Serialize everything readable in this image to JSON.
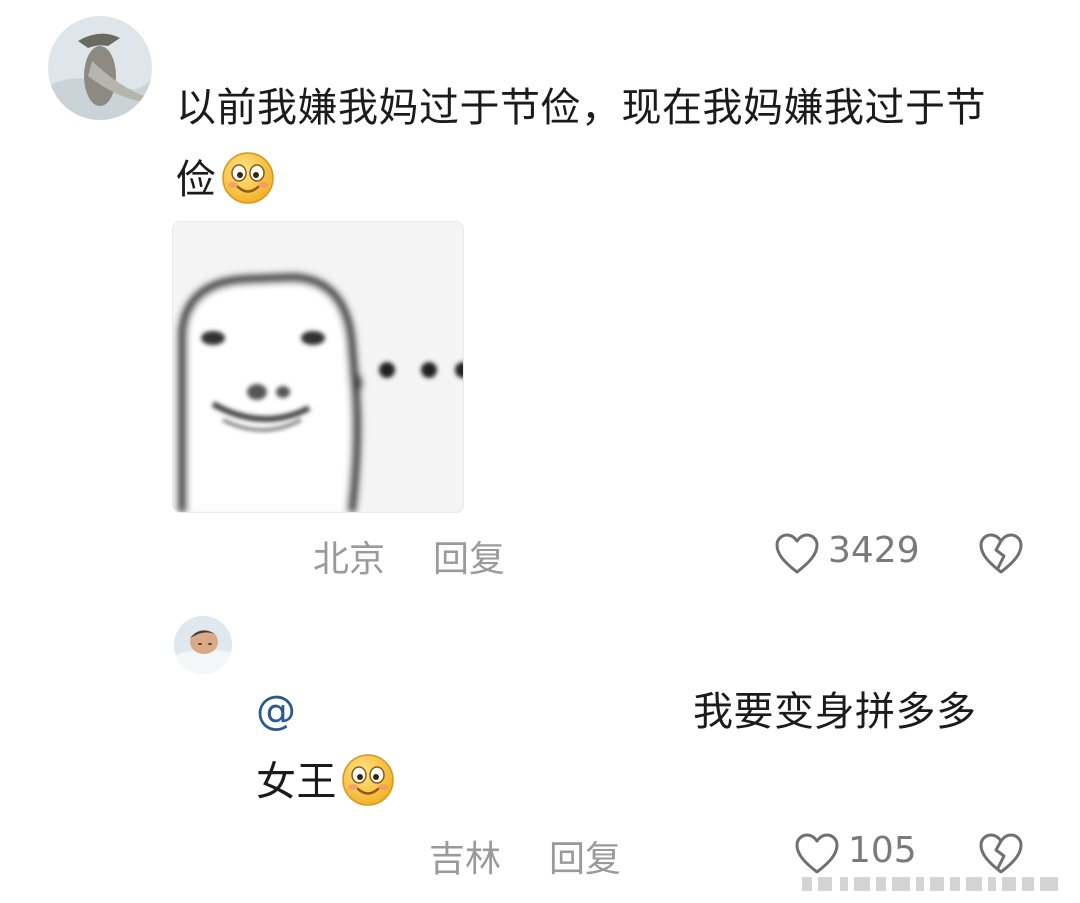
{
  "comments": [
    {
      "text_line1": "以前我嫌我妈过于节俭，现在我妈嫌我过于节",
      "text_line2": "俭",
      "location": "北京",
      "reply_label": "回复",
      "likes": "3429",
      "emoji_icon": "smile-emoji-icon"
    }
  ],
  "reply": {
    "mention": "@",
    "text_line1": "我要变身拼多多",
    "text_line2": "女王",
    "location": "吉林",
    "reply_label": "回复",
    "likes": "105",
    "emoji_icon": "smile-emoji-icon"
  },
  "colors": {
    "text": "#1b1b1b",
    "meta": "#9a9a9a",
    "mention": "#2b5a8c",
    "icon": "#6f6f6f"
  }
}
